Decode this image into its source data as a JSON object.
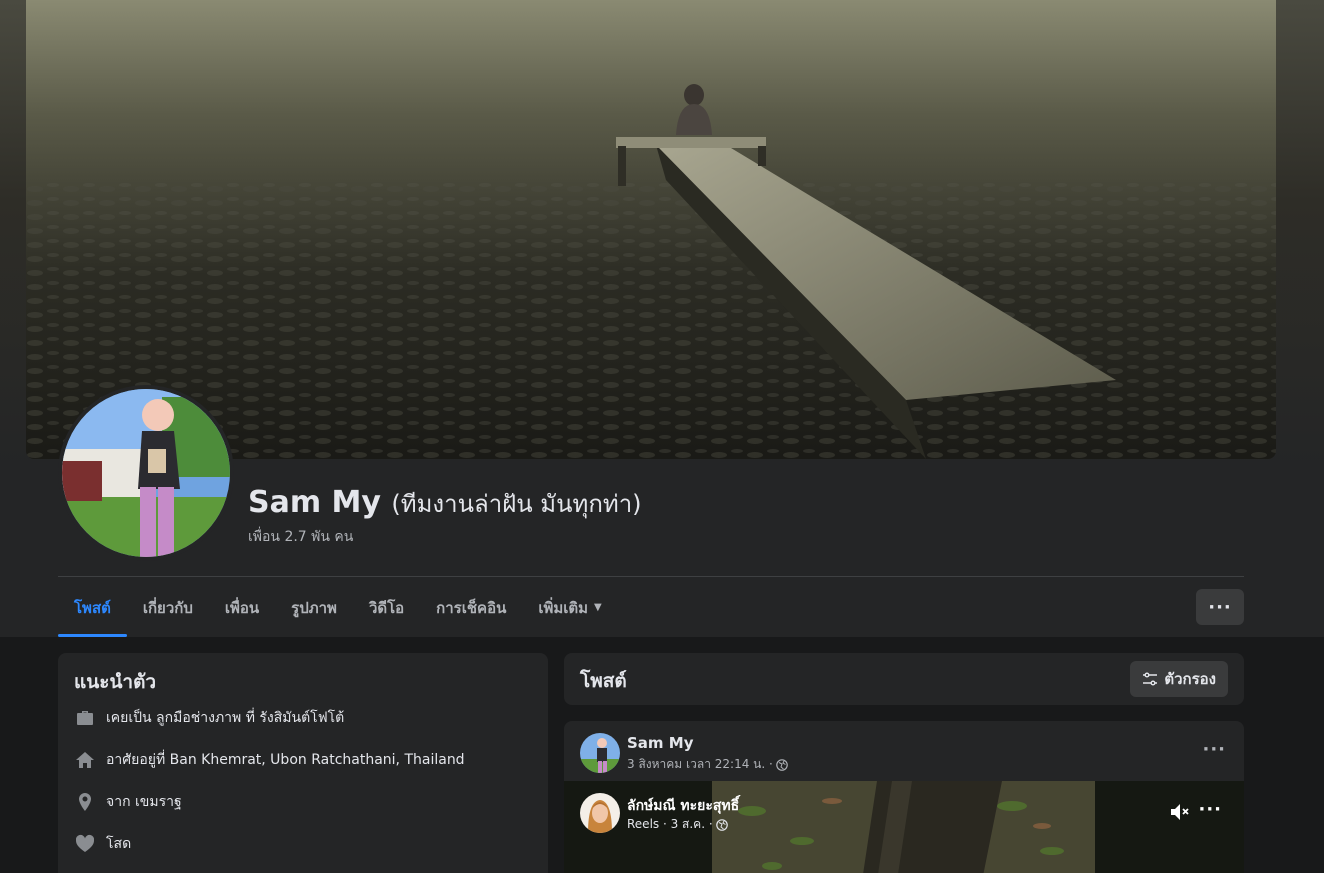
{
  "profile": {
    "name": "Sam My",
    "alternate_name": "(ทีมงานล่าฝัน มันทุกท่า)",
    "friends_count": "เพื่อน 2.7 พัน คน"
  },
  "tabs": [
    {
      "label": "โพสต์",
      "active": true
    },
    {
      "label": "เกี่ยวกับ"
    },
    {
      "label": "เพื่อน"
    },
    {
      "label": "รูปภาพ"
    },
    {
      "label": "วิดีโอ"
    },
    {
      "label": "การเช็คอิน"
    },
    {
      "label": "เพิ่มเติม"
    }
  ],
  "intro": {
    "title": "แนะนำตัว",
    "items": [
      {
        "icon": "briefcase-icon",
        "text": "เคยเป็น ลูกมือช่างภาพ ที่ รังสิมันต์โฟโต้"
      },
      {
        "icon": "home-icon",
        "text": "อาศัยอยู่ที่ Ban Khemrat, Ubon Ratchathani, Thailand"
      },
      {
        "icon": "location-pin-icon",
        "text": "จาก เขมราฐ"
      },
      {
        "icon": "heart-icon",
        "text": "โสด"
      }
    ]
  },
  "posts_section": {
    "title": "โพสต์",
    "filter_label": "ตัวกรอง"
  },
  "post": {
    "author": "Sam My",
    "meta": "3 สิงหาคม เวลา 22:14 น. ·",
    "shared_reel": {
      "author": "ลักษ์มณี ทะยะสุทธิ์",
      "meta": "Reels · 3 ส.ค. ·"
    }
  },
  "colors": {
    "accent": "#2d88ff",
    "background": "#18191a",
    "card": "#242526"
  }
}
